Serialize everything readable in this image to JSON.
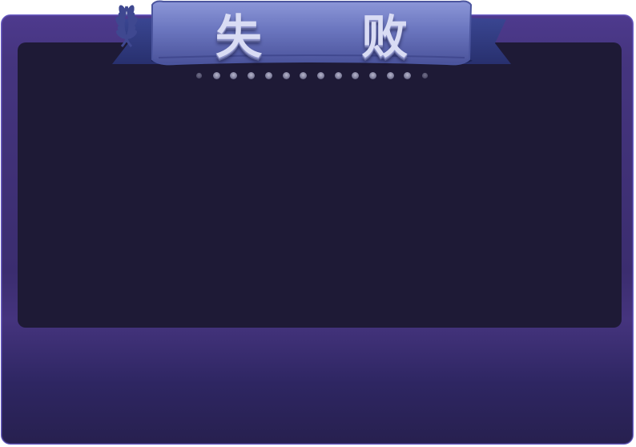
{
  "banner": {
    "title": "失 败",
    "ribbon_color": "#6a76bf",
    "ribbon_shadow_color": "#2f3a7a",
    "title_color": "#d9dcf4",
    "laurel_icon": "laurel-branch-icon"
  },
  "panel": {
    "border_color": "#6a5fc8",
    "outer_color": "#4e3a8e",
    "inner_color": "#1e1a36"
  },
  "separator": {
    "dot_count": 14,
    "dot_color": "#9a99b4"
  }
}
